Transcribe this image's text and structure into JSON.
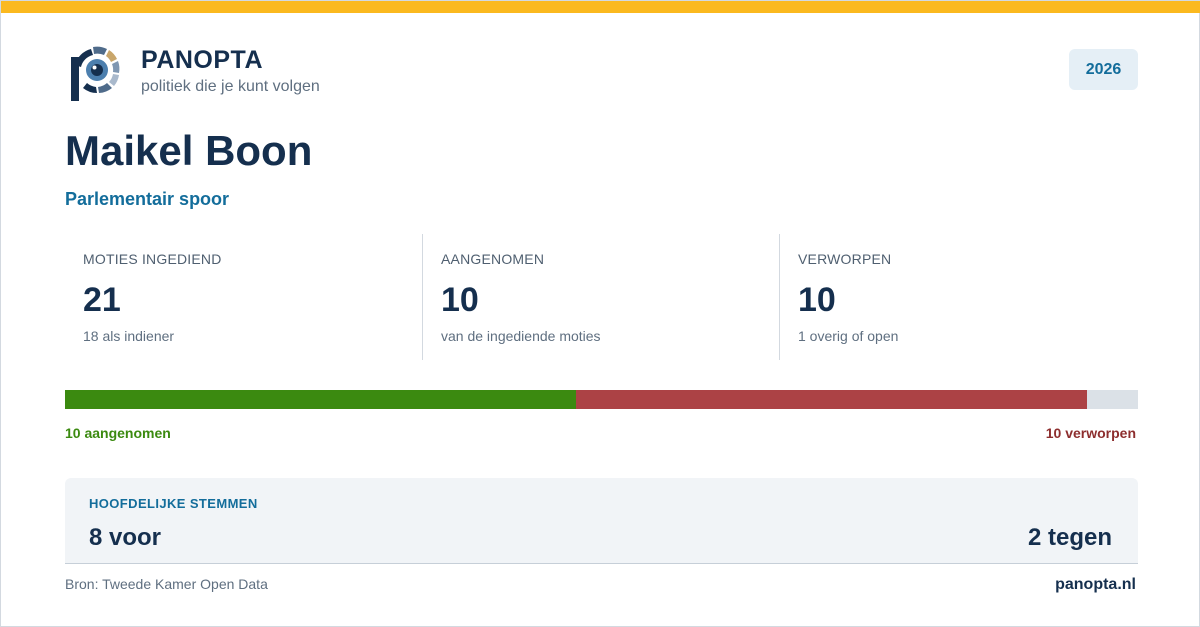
{
  "brand": {
    "name": "PANOPTA",
    "tagline": "politiek die je kunt volgen",
    "logo_icon": "eye-p-logo-icon",
    "colors": {
      "accent": "#fbb91f",
      "navy": "#152f4e",
      "blue": "#136d9b",
      "green": "#3b8a10",
      "red": "#ac4245"
    }
  },
  "year": "2026",
  "person": {
    "name": "Maikel Boon",
    "section": "Parlementair spoor"
  },
  "stats": [
    {
      "label": "MOTIES INGEDIEND",
      "value": "21",
      "note": "18 als indiener"
    },
    {
      "label": "AANGENOMEN",
      "value": "10",
      "note": "van de ingediende moties"
    },
    {
      "label": "VERWORPEN",
      "value": "10",
      "note": "1 overig of open"
    }
  ],
  "progress": {
    "total": 21,
    "accepted": 10,
    "rejected": 10,
    "other": 1,
    "accepted_label": "10 aangenomen",
    "rejected_label": "10 verworpen"
  },
  "votes": {
    "title": "HOOFDELIJKE STEMMEN",
    "for_label": "8 voor",
    "against_label": "2 tegen"
  },
  "footer": {
    "source": "Bron: Tweede Kamer Open Data",
    "site": "panopta.nl"
  }
}
